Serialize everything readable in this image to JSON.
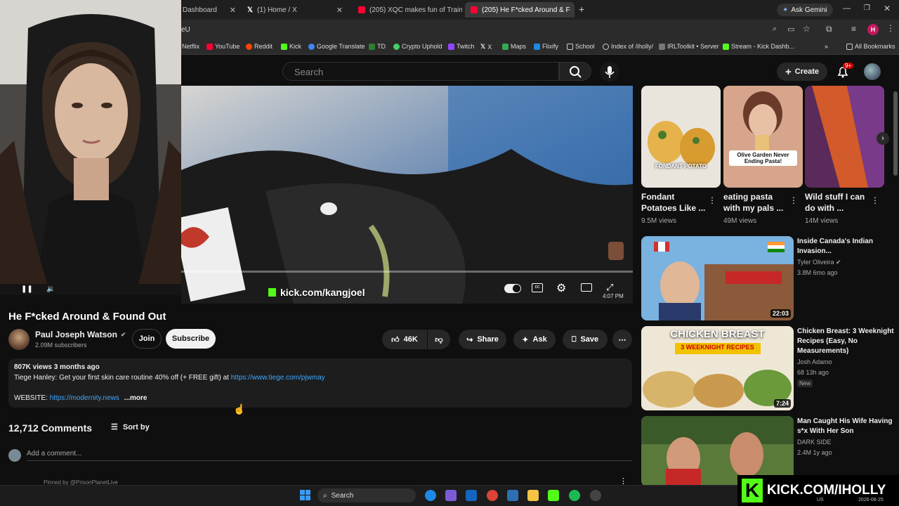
{
  "browser": {
    "tabs": [
      {
        "title": "Dashboard"
      },
      {
        "title": "(1) Home / X"
      },
      {
        "title": "(205) XQC makes fun of Trainw"
      },
      {
        "title": "(205) He F*cked Around & F"
      }
    ],
    "ask_gemini": "Ask Gemini",
    "address_fragment": "eU",
    "bookmarks": [
      "Netflix",
      "YouTube",
      "Reddit",
      "Kick",
      "Google Translate",
      "TD",
      "Crypto Uphold",
      "Twitch",
      "X",
      "Maps",
      "Flixify",
      "School",
      "Index of /iholly/",
      "IRLToolkit • Server",
      "Stream - Kick Dashb...",
      "All Bookmarks"
    ],
    "profile_initial": "H"
  },
  "youtube": {
    "search_placeholder": "Search",
    "create_label": "Create",
    "notif_count": "9+"
  },
  "player": {
    "overlay_url": "kick.com/kangjoel",
    "time_text": "4:07 PM"
  },
  "video": {
    "title": "He F*cked Around & Found Out",
    "channel": "Paul Joseph Watson",
    "subscribers": "2.09M subscribers",
    "join": "Join",
    "subscribe": "Subscribe",
    "likes": "46K",
    "share": "Share",
    "ask": "Ask",
    "save": "Save",
    "views_line": "807K views  3 months ago",
    "desc_text": "Tiege Hanley: Get your first skin care routine 40% off (+ FREE gift) at",
    "desc_link": "https://www.tiege.com/pjwmay",
    "website_label": "WEBSITE:",
    "website_link": "https://modernity.news",
    "more": "...more"
  },
  "comments": {
    "count": "12,712 Comments",
    "sort": "Sort by",
    "placeholder": "Add a comment...",
    "pinned": "Pinned by @PrisonPlanetLive"
  },
  "shorts": [
    {
      "title": "Fondant Potatoes Like ...",
      "views": "9.5M views",
      "overlay": "FONDANT POTATO"
    },
    {
      "title": "eating pasta with my pals ...",
      "views": "49M views",
      "overlay": "Olive Garden Never Ending Pasta!"
    },
    {
      "title": "Wild stuff I can do with ...",
      "views": "14M views",
      "overlay": ""
    }
  ],
  "recommended": [
    {
      "title": "Inside Canada's Indian Invasion...",
      "channel": "Tyler Oliveira",
      "meta": "3.8M  6mo ago",
      "duration": "22:03",
      "badge": ""
    },
    {
      "title": "Chicken Breast: 3 Weeknight Recipes (Easy, No Measurements)",
      "channel": "Josh Adamo",
      "meta": "68  13h ago",
      "duration": "7:24",
      "badge": "New",
      "overlay1": "CHICKEN BREAST",
      "overlay2": "3 WEEKNIGHT RECIPES"
    },
    {
      "title": "Man Caught His Wife Having s*x With Her Son",
      "channel": "DARK SIDE",
      "meta": "2.4M  1y ago",
      "duration": "",
      "badge": ""
    }
  ],
  "taskbar": {
    "search": "Search",
    "watermark": "KICK.COM/IHOLLY",
    "locale": "US",
    "date": "2026-08-25"
  },
  "colors": {
    "accent_red": "#ff0033",
    "kick_green": "#53fc18",
    "link": "#3ea6ff"
  }
}
